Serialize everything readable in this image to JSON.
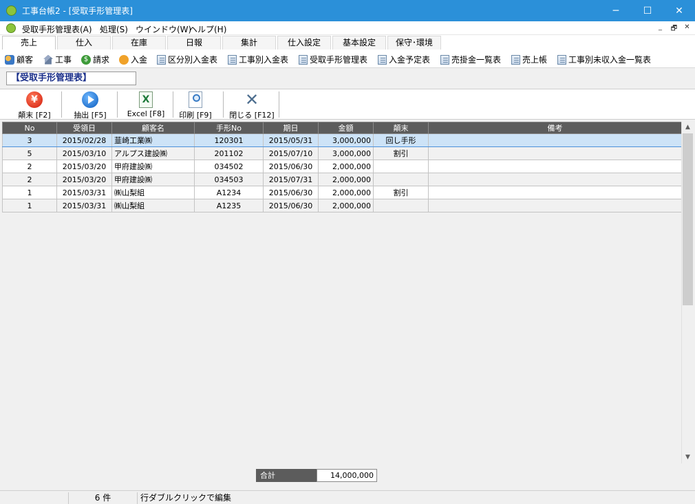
{
  "window": {
    "title": "工事台帳2 - [受取手形管理表]",
    "minimize": "─",
    "maximize": "☐",
    "close": "✕"
  },
  "menu": {
    "items": [
      "受取手形管理表(A)",
      "処理(S)",
      "ウインドウ(W)",
      "ヘルプ(H)"
    ],
    "mdi_min": "_",
    "mdi_restore": "🗗",
    "mdi_close": "✕"
  },
  "tabs": [
    "売上",
    "仕入",
    "在庫",
    "日報",
    "集計",
    "仕入設定",
    "基本設定",
    "保守･環境"
  ],
  "active_tab": "売上",
  "links": [
    {
      "label": "顧客",
      "icon": "customers-icon"
    },
    {
      "label": "工事",
      "icon": "house-icon"
    },
    {
      "label": "請求",
      "icon": "dollar-icon"
    },
    {
      "label": "入金",
      "icon": "coin-icon"
    },
    {
      "label": "区分別入金表",
      "icon": "document-icon"
    },
    {
      "label": "工事別入金表",
      "icon": "document-icon"
    },
    {
      "label": "受取手形管理表",
      "icon": "document-icon"
    },
    {
      "label": "入金予定表",
      "icon": "document-icon"
    },
    {
      "label": "売掛金一覧表",
      "icon": "document-icon"
    },
    {
      "label": "売上帳",
      "icon": "document-icon"
    },
    {
      "label": "工事別未収入金一覧表",
      "icon": "document-icon"
    }
  ],
  "page_heading": "【受取手形管理表】",
  "actions": [
    {
      "label": "顛末 [F2]",
      "icon": "yen-icon"
    },
    {
      "label": "抽出 [F5]",
      "icon": "play-icon"
    },
    {
      "label": "Excel [F8]",
      "icon": "excel-icon"
    },
    {
      "label": "印刷 [F9]",
      "icon": "print-preview-icon"
    },
    {
      "label": "閉じる [F12]",
      "icon": "close-x-icon"
    }
  ],
  "table": {
    "columns": [
      "No",
      "受領日",
      "顧客名",
      "手形No",
      "期日",
      "金額",
      "顛末",
      "備考"
    ],
    "rows": [
      [
        "3",
        "2015/02/28",
        "韮崎工業㈱",
        "120301",
        "2015/05/31",
        "3,000,000",
        "回し手形",
        ""
      ],
      [
        "5",
        "2015/03/10",
        "アルプス建設㈱",
        "201102",
        "2015/07/10",
        "3,000,000",
        "割引",
        ""
      ],
      [
        "2",
        "2015/03/20",
        "甲府建設㈱",
        "034502",
        "2015/06/30",
        "2,000,000",
        "",
        ""
      ],
      [
        "2",
        "2015/03/20",
        "甲府建設㈱",
        "034503",
        "2015/07/31",
        "2,000,000",
        "",
        ""
      ],
      [
        "1",
        "2015/03/31",
        "㈱山梨組",
        "A1234",
        "2015/06/30",
        "2,000,000",
        "割引",
        ""
      ],
      [
        "1",
        "2015/03/31",
        "㈱山梨組",
        "A1235",
        "2015/06/30",
        "2,000,000",
        "",
        ""
      ]
    ],
    "selected_row": 0
  },
  "total": {
    "label": "合計",
    "value": "14,000,000"
  },
  "status": {
    "count": "6 件",
    "hint": "行ダブルクリックで編集"
  },
  "colors": {
    "titlebar": "#2b90d9",
    "header": "#5c5c5c",
    "selected": "#cde3f7",
    "heading_text": "#1a2f8a"
  }
}
